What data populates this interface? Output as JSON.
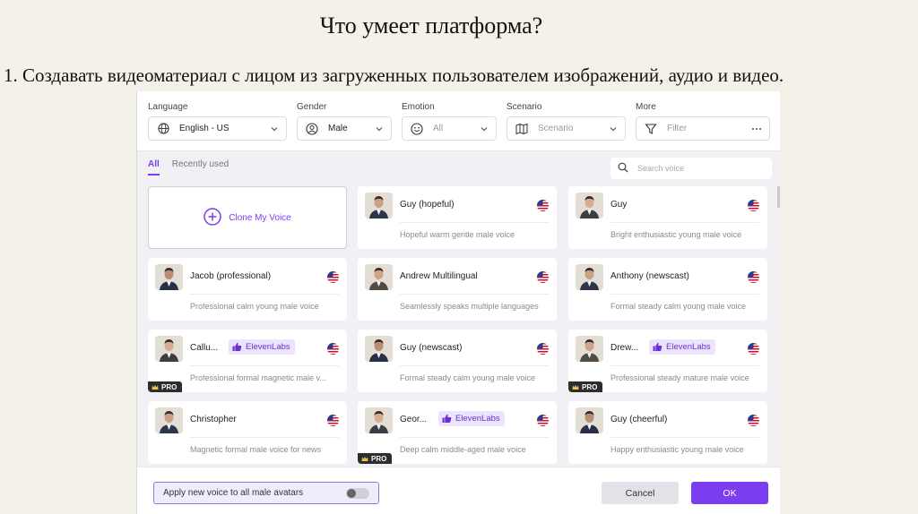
{
  "slide": {
    "title": "Что умеет платформа?",
    "text": "1. Создавать видеоматериал с лицом из загруженных пользователем изображений, аудио и видео."
  },
  "filters": {
    "language": {
      "label": "Language",
      "value": "English - US",
      "icon": "globe-icon"
    },
    "gender": {
      "label": "Gender",
      "value": "Male",
      "icon": "user-icon"
    },
    "emotion": {
      "label": "Emotion",
      "value": "All",
      "icon": "smile-icon"
    },
    "scenario": {
      "label": "Scenario",
      "value": "Scenario",
      "icon": "map-icon"
    },
    "more": {
      "label": "More",
      "value": "Filter",
      "icon": "filter-icon"
    }
  },
  "tabs": [
    {
      "label": "All",
      "active": true
    },
    {
      "label": "Recently used",
      "active": false
    }
  ],
  "search": {
    "placeholder": "Search voice"
  },
  "clone_label": "Clone My Voice",
  "voices": [
    {
      "name": "Guy (hopeful)",
      "desc": "Hopeful warm gentle male voice",
      "badge": "",
      "pro": false
    },
    {
      "name": "Guy",
      "desc": "Bright enthusiastic young male voice",
      "badge": "",
      "pro": false
    },
    {
      "name": "Jacob (professional)",
      "desc": "Professional calm young male voice",
      "badge": "",
      "pro": false
    },
    {
      "name": "Andrew Multilingual",
      "desc": "Seamlessly speaks multiple languages",
      "badge": "",
      "pro": false
    },
    {
      "name": "Anthony (newscast)",
      "desc": "Formal steady calm young male voice",
      "badge": "",
      "pro": false
    },
    {
      "name": "Callu...",
      "desc": "Professional formal magnetic male v...",
      "badge": "ElevenLabs",
      "pro": true
    },
    {
      "name": "Guy (newscast)",
      "desc": "Formal steady calm young male voice",
      "badge": "",
      "pro": false
    },
    {
      "name": "Drew...",
      "desc": "Professional steady mature male voice",
      "badge": "ElevenLabs",
      "pro": true
    },
    {
      "name": "Christopher",
      "desc": "Magnetic formal male voice for news",
      "badge": "",
      "pro": false
    },
    {
      "name": "Geor...",
      "desc": "Deep calm middle-aged male voice",
      "badge": "ElevenLabs",
      "pro": true
    },
    {
      "name": "Guy (cheerful)",
      "desc": "Happy enthusiastic young male voice",
      "badge": "",
      "pro": false
    }
  ],
  "pro_label": "PRO",
  "footer": {
    "apply_label": "Apply new voice to all male avatars",
    "apply_on": false,
    "cancel_label": "Cancel",
    "ok_label": "OK"
  },
  "colors": {
    "accent": "#7a3df0",
    "pro_bg": "#2d2d2d"
  }
}
